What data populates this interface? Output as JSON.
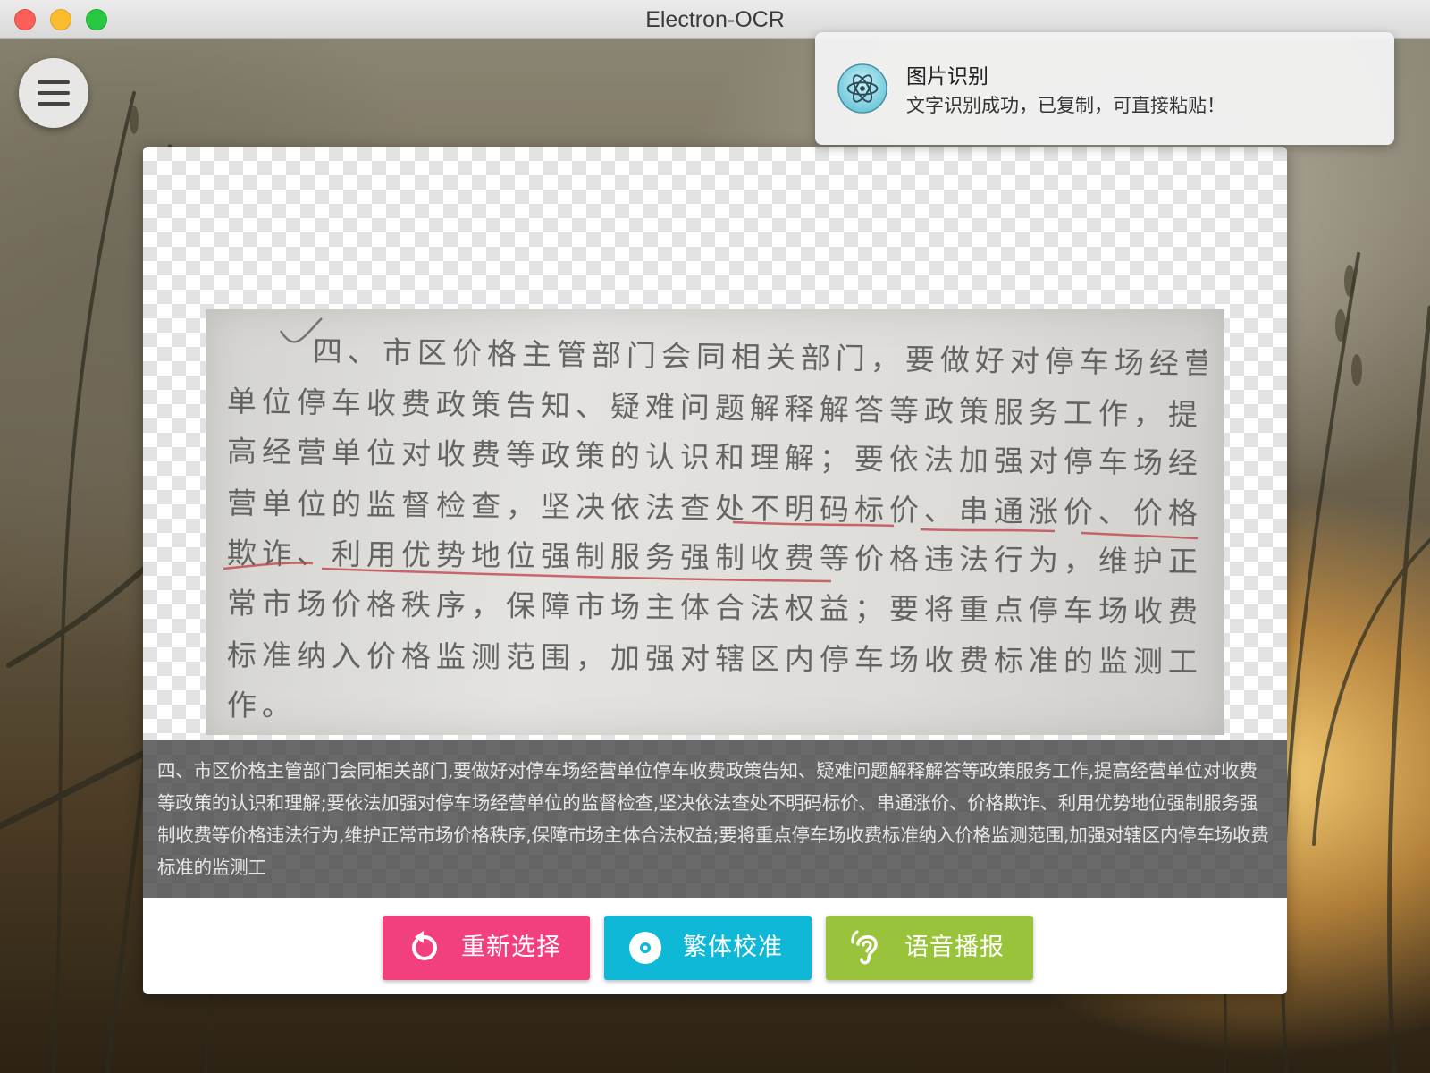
{
  "window": {
    "title": "Electron-OCR"
  },
  "notification": {
    "title": "图片识别",
    "body": "文字识别成功，已复制，可直接粘贴！",
    "icon": "electron-atom-icon"
  },
  "menu": {
    "icon": "hamburger-menu-icon"
  },
  "document_image": {
    "lines": [
      "四、市区价格主管部门会同相关部门，要做好对停车场经营",
      "单位停车收费政策告知、疑难问题解释解答等政策服务工作，提",
      "高经营单位对收费等政策的认识和理解；要依法加强对停车场经",
      "营单位的监督检查，坚决依法查处不明码标价、串通涨价、价格",
      "欺诈、利用优势地位强制服务强制收费等价格违法行为，维护正",
      "常市场价格秩序，保障市场主体合法权益；要将重点停车场收费",
      "标准纳入价格监测范围，加强对辖区内停车场收费标准的监测工",
      "作。"
    ]
  },
  "ocr_result": {
    "text": "四、市区价格主管部门会同相关部门,要做好对停车场经营单位停车收费政策告知、疑难问题解释解答等政策服务工作,提高经营单位对收费等政策的认识和理解;要依法加强对停车场经营单位的监督检查,坚决依法查处不明码标价、串通涨价、价格欺诈、利用优势地位强制服务强制收费等价格违法行为,维护正常市场价格秩序,保障市场主体合法权益;要将重点停车场收费标准纳入价格监测范围,加强对辖区内停车场收费标准的监测工"
  },
  "buttons": {
    "reselect": {
      "label": "重新选择",
      "icon": "refresh-icon",
      "color": "#f2407e"
    },
    "traditional": {
      "label": "繁体校准",
      "icon": "disc-icon",
      "color": "#0fb8d6"
    },
    "speech": {
      "label": "语音播报",
      "icon": "ear-icon",
      "color": "#9ac33c"
    }
  }
}
